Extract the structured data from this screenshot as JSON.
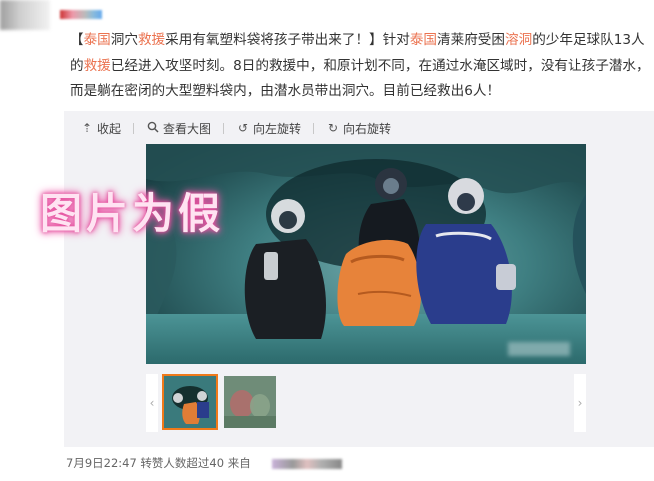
{
  "post": {
    "lines": [
      [
        {
          "t": "【",
          "hl": false
        },
        {
          "t": "泰国",
          "hl": true
        },
        {
          "t": "洞穴",
          "hl": false
        },
        {
          "t": "救援",
          "hl": true
        },
        {
          "t": "采用有氧塑料袋将孩子带出来了！】针对",
          "hl": false
        },
        {
          "t": "泰国",
          "hl": true
        },
        {
          "t": "清莱府受困",
          "hl": false
        },
        {
          "t": "溶洞",
          "hl": true
        },
        {
          "t": "的少年足球队13人",
          "hl": false
        }
      ],
      [
        {
          "t": "的",
          "hl": false
        },
        {
          "t": "救援",
          "hl": true
        },
        {
          "t": "已经进入攻坚时刻。8日的救援中，和原计划不同，在通过水淹区域时，没有让孩子潜水，",
          "hl": false
        }
      ],
      [
        {
          "t": "而是躺在密闭的大型塑料袋内，由潜水员带出洞穴。目前已经救出6人！",
          "hl": false
        }
      ]
    ]
  },
  "toolbar": {
    "collapse": "收起",
    "view_large": "查看大图",
    "rotate_left": "向左旋转",
    "rotate_right": "向右旋转"
  },
  "photo": {
    "watermark": "图片为假"
  },
  "thumbnails": {
    "count": 2,
    "selected_index": 0
  },
  "footer": {
    "meta": "7月9日22:47 转赞人数超过40 来自 "
  },
  "colors": {
    "highlight": "#eb7350",
    "selected_thumb_border": "#f07a1a",
    "media_bg": "#f2f2f5"
  },
  "icons": [
    "collapse-arrow-icon",
    "magnifier-icon",
    "rotate-left-icon",
    "rotate-right-icon",
    "chevron-left-icon",
    "chevron-right-icon"
  ]
}
